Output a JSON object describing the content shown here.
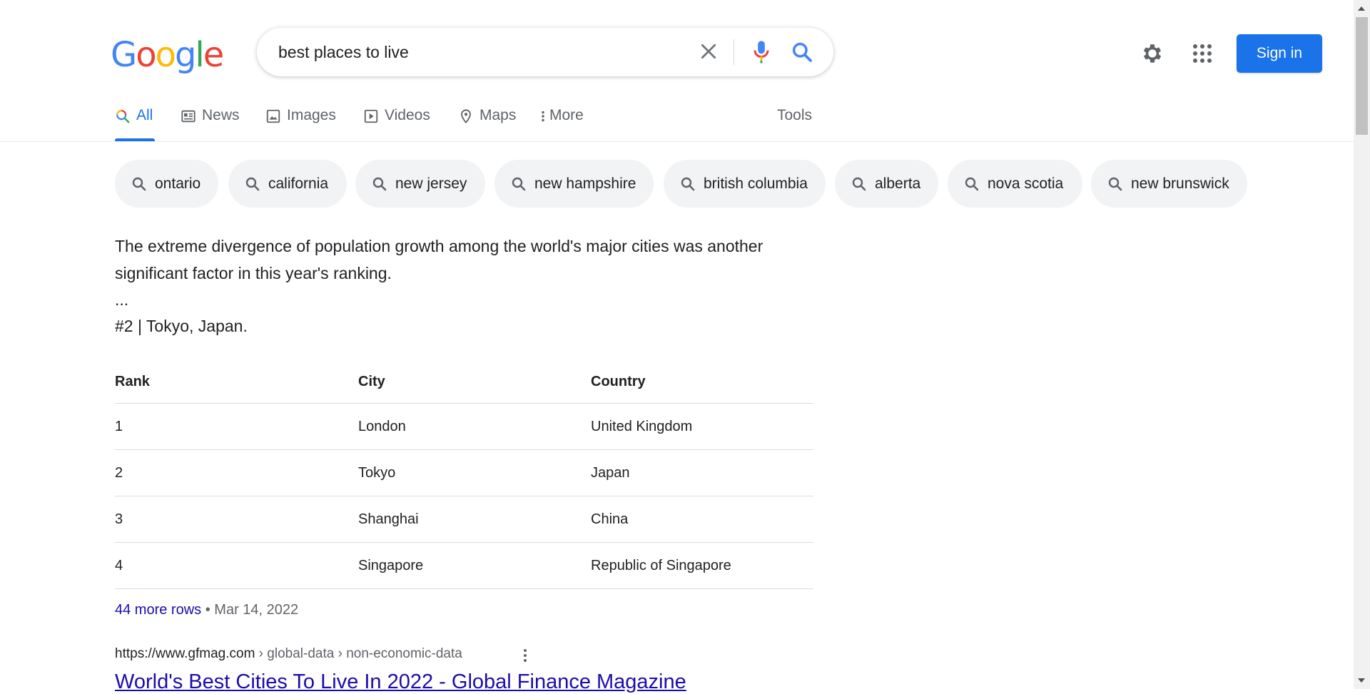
{
  "logo": {
    "letters": [
      {
        "char": "G",
        "color": "#4285F4"
      },
      {
        "char": "o",
        "color": "#EA4335"
      },
      {
        "char": "o",
        "color": "#FBBC05"
      },
      {
        "char": "g",
        "color": "#4285F4"
      },
      {
        "char": "l",
        "color": "#34A853"
      },
      {
        "char": "e",
        "color": "#EA4335"
      }
    ]
  },
  "search": {
    "query": "best places to live"
  },
  "header": {
    "sign_in": "Sign in"
  },
  "tabs": [
    {
      "label": "All",
      "icon": "search-icon",
      "active": true
    },
    {
      "label": "News",
      "icon": "news-icon"
    },
    {
      "label": "Images",
      "icon": "image-icon"
    },
    {
      "label": "Videos",
      "icon": "video-icon"
    },
    {
      "label": "Maps",
      "icon": "map-pin-icon"
    },
    {
      "label": "More",
      "icon": "more-vert-icon"
    },
    {
      "label": "Tools"
    }
  ],
  "chips": [
    "ontario",
    "california",
    "new jersey",
    "new hampshire",
    "british columbia",
    "alberta",
    "nova scotia",
    "new brunswick"
  ],
  "snippet": {
    "text_line1": "The extreme divergence of population growth among the world's major cities was another",
    "text_line2": "significant factor in this year's ranking.",
    "ellipsis": "...",
    "highlight": "#2 | Tokyo, Japan."
  },
  "table": {
    "headers": [
      "Rank",
      "City",
      "Country"
    ],
    "rows": [
      [
        "1",
        "London",
        "United Kingdom"
      ],
      [
        "2",
        "Tokyo",
        "Japan"
      ],
      [
        "3",
        "Shanghai",
        "China"
      ],
      [
        "4",
        "Singapore",
        "Republic of Singapore"
      ]
    ]
  },
  "more_rows": {
    "link": "44 more rows",
    "separator": " • ",
    "date": "Mar 14, 2022"
  },
  "result": {
    "domain": "https://www.gfmag.com",
    "path": " › global-data › non-economic-data",
    "title": "World's Best Cities To Live In 2022 - Global Finance Magazine"
  },
  "colors": {
    "accent": "#1a73e8",
    "link": "#1a0dab",
    "chip_bg": "#f1f3f4"
  }
}
